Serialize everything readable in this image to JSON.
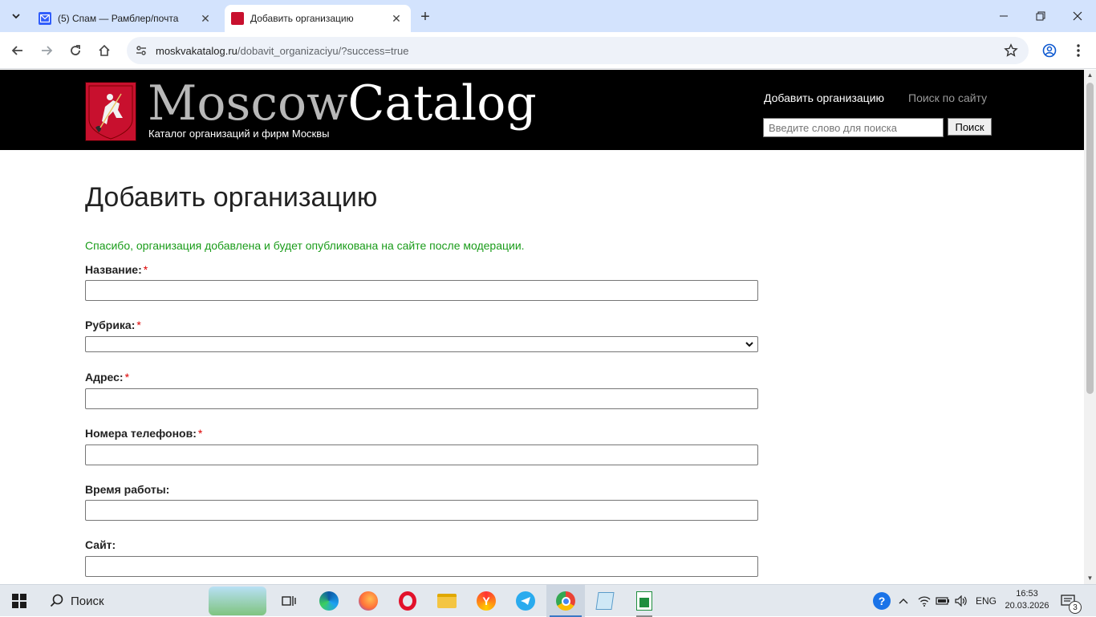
{
  "browser": {
    "tabs": [
      {
        "title": "(5) Спам — Рамблер/почта",
        "active": false
      },
      {
        "title": "Добавить организацию",
        "active": true
      }
    ],
    "url_host": "moskvakatalog.ru",
    "url_path": "/dobavit_organizaciyu/?success=true"
  },
  "header": {
    "logo_part1": "Moscow",
    "logo_part2": "Catalog",
    "tagline": "Каталог организаций и фирм Москвы",
    "nav_add": "Добавить организацию",
    "nav_search": "Поиск по сайту",
    "search_placeholder": "Введите слово для поиска",
    "search_button": "Поиск"
  },
  "main": {
    "title": "Добавить организацию",
    "success_message": "Спасибо, организация добавлена и будет опубликована на сайте после модерации.",
    "fields": [
      {
        "label": "Название:",
        "required": "*",
        "type": "text",
        "value": ""
      },
      {
        "label": "Рубрика:",
        "required": "*",
        "type": "select",
        "value": ""
      },
      {
        "label": "Адрес:",
        "required": "*",
        "type": "text",
        "value": ""
      },
      {
        "label": "Номера телефонов:",
        "required": "*",
        "type": "text",
        "value": ""
      },
      {
        "label": "Время работы:",
        "required": "",
        "type": "text",
        "value": ""
      },
      {
        "label": "Сайт:",
        "required": "",
        "type": "text",
        "value": ""
      }
    ]
  },
  "taskbar": {
    "search_label": "Поиск",
    "language": "ENG",
    "time": "16:53",
    "date": "20.03.2026",
    "notifications": "3"
  }
}
